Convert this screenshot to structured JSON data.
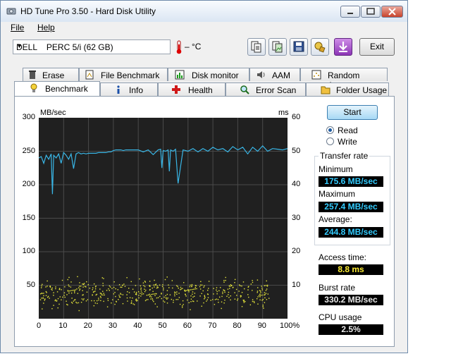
{
  "window": {
    "title": "HD Tune Pro 3.50 - Hard Disk Utility"
  },
  "menu": {
    "file": "File",
    "help": "Help"
  },
  "toolbar": {
    "drive": "DELL    PERC 5/i (62 GB)",
    "temperature": "– °C",
    "exit_label": "Exit",
    "icons": [
      "copy-text-icon",
      "copy-image-icon",
      "save-icon",
      "options-icon",
      "download-icon"
    ]
  },
  "tabs": {
    "top": [
      "Erase",
      "File Benchmark",
      "Disk monitor",
      "AAM",
      "Random Access"
    ],
    "bottom": [
      "Benchmark",
      "Info",
      "Health",
      "Error Scan",
      "Folder Usage"
    ],
    "active": "Benchmark"
  },
  "chart_data": {
    "type": "line",
    "y_left_label": "MB/sec",
    "y_right_label": "ms",
    "y_left_ticks": [
      "300",
      "250",
      "200",
      "150",
      "100",
      "50"
    ],
    "y_right_ticks": [
      "60",
      "50",
      "40",
      "30",
      "20",
      "10"
    ],
    "x_ticks": [
      "0",
      "10",
      "20",
      "30",
      "40",
      "50",
      "60",
      "70",
      "80",
      "90",
      "100%"
    ],
    "ylim_left": [
      0,
      300
    ],
    "ylim_right": [
      0,
      60
    ],
    "xlim": [
      0,
      100
    ],
    "series": [
      {
        "type": "line",
        "color": "#39b6e6",
        "x": [
          0,
          1,
          2,
          3,
          4,
          5,
          5.5,
          6,
          7,
          8,
          9,
          10,
          11,
          12,
          13,
          14,
          15,
          16,
          17,
          18,
          19,
          20,
          21,
          22,
          23,
          24,
          25,
          26,
          27,
          28,
          29,
          30,
          31,
          32,
          33,
          34,
          35,
          36,
          37,
          38,
          39,
          40,
          42,
          44,
          46,
          48,
          49,
          49.5,
          50,
          51,
          52,
          52.5,
          53,
          54,
          55,
          56,
          58,
          60,
          62,
          64,
          66,
          68,
          70,
          72,
          74,
          76,
          78,
          80,
          82,
          84,
          86,
          88,
          90,
          92,
          94,
          96,
          98,
          100
        ],
        "y": [
          240,
          242,
          232,
          244,
          238,
          246,
          186,
          244,
          240,
          246,
          232,
          248,
          244,
          238,
          246,
          224,
          246,
          248,
          246,
          247,
          246,
          247,
          247,
          247,
          247,
          248,
          248,
          248,
          248,
          249,
          249,
          251,
          252,
          252,
          252,
          251,
          252,
          252,
          252,
          252,
          252,
          252,
          249,
          252,
          245,
          252,
          253,
          225,
          251,
          250,
          252,
          220,
          252,
          250,
          253,
          202,
          252,
          250,
          254,
          249,
          254,
          250,
          256,
          252,
          254,
          249,
          257,
          252,
          256,
          246,
          256,
          250,
          258,
          250,
          254,
          253,
          252,
          254
        ]
      },
      {
        "type": "scatter",
        "color": "#e8e83a",
        "axis": "right",
        "cluster_ms": [
          2,
          14
        ],
        "cluster_center_ms": 8.8
      }
    ]
  },
  "controls": {
    "start": "Start",
    "read": "Read",
    "write": "Write"
  },
  "results": {
    "transfer_rate": "Transfer rate",
    "minimum_label": "Minimum",
    "minimum": "175.6 MB/sec",
    "maximum_label": "Maximum",
    "maximum": "257.4 MB/sec",
    "average_label": "Average:",
    "average": "244.8 MB/sec",
    "access_label": "Access time:",
    "access": "8.8 ms",
    "burst_label": "Burst rate",
    "burst": "330.2 MB/sec",
    "cpu_label": "CPU usage",
    "cpu": "2.5%"
  }
}
